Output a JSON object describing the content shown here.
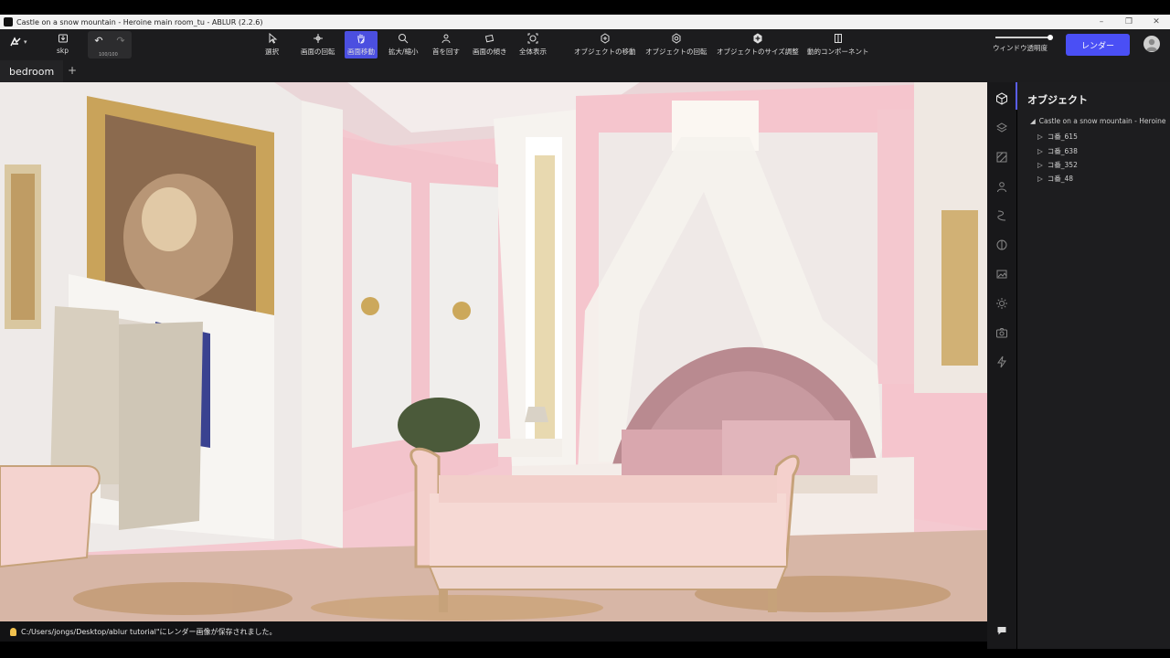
{
  "window": {
    "title": "Castle on a snow mountain - Heroine main room_tu - ABLUR (2.2.6)",
    "controls": [
      "–",
      "❐",
      "✕"
    ]
  },
  "toolbar": {
    "file_label": "skp",
    "undo_counter": "100/100",
    "tools": [
      {
        "label": "選択",
        "icon": "cursor-icon"
      },
      {
        "label": "画面の回転",
        "icon": "orbit-icon"
      },
      {
        "label": "画面移動",
        "icon": "hand-icon",
        "active": true
      },
      {
        "label": "拡大/縮小",
        "icon": "zoom-icon"
      },
      {
        "label": "首を回す",
        "icon": "look-around-icon"
      },
      {
        "label": "画面の傾き",
        "icon": "tilt-icon"
      },
      {
        "label": "全体表示",
        "icon": "zoom-extents-icon"
      },
      {
        "label": "オブジェクトの移動",
        "icon": "move-object-icon"
      },
      {
        "label": "オブジェクトの回転",
        "icon": "rotate-object-icon"
      },
      {
        "label": "オブジェクトのサイズ調整",
        "icon": "scale-object-icon"
      },
      {
        "label": "動的コンポーネント",
        "icon": "dynamic-component-icon"
      }
    ],
    "window_opacity_label": "ウィンドウ透明度",
    "window_opacity": 1.0,
    "render_button": "レンダー",
    "accent_color": "#4a4ff5"
  },
  "tabs": {
    "active": "bedroom",
    "add_label": "+"
  },
  "panel": {
    "title": "オブジェクト",
    "root": "Castle on a snow mountain - Heroine",
    "items": [
      "コ番_615",
      "コ番_638",
      "コ番_352",
      "コ番_48"
    ]
  },
  "status": {
    "message": "C:/Users/jongs/Desktop/ablur tutorial\"にレンダー画像が保存されました。"
  },
  "side_icons": [
    "cube-icon",
    "layers-icon",
    "material-icon",
    "person-icon",
    "path-icon",
    "environment-icon",
    "image-icon",
    "sun-icon",
    "camera-icon",
    "lightning-icon"
  ]
}
